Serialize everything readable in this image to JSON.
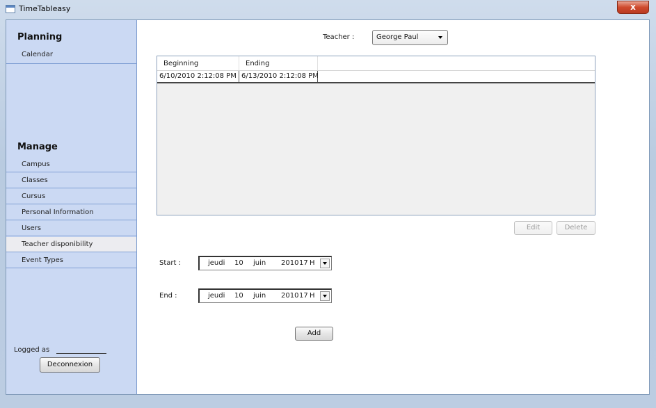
{
  "window": {
    "title": "TimeTableasy",
    "close_label": "x"
  },
  "sidebar": {
    "planning_title": "Planning",
    "planning_items": [
      {
        "label": "Calendar"
      }
    ],
    "manage_title": "Manage",
    "manage_items": [
      {
        "label": "Campus"
      },
      {
        "label": "Classes"
      },
      {
        "label": "Cursus"
      },
      {
        "label": "Personal Information"
      },
      {
        "label": "Users"
      },
      {
        "label": "Teacher disponibility"
      },
      {
        "label": "Event Types"
      }
    ],
    "selected_item": "Teacher disponibility",
    "logged_as_label": "Logged as",
    "logout_label": "Deconnexion"
  },
  "teacher": {
    "label": "Teacher :",
    "selected": "George Paul"
  },
  "grid": {
    "columns": [
      "Beginning",
      "Ending"
    ],
    "rows": [
      [
        "6/10/2010 2:12:08 PM",
        "6/13/2010 2:12:08 PM"
      ]
    ]
  },
  "actions": {
    "edit_label": "Edit",
    "delete_label": "Delete",
    "add_label": "Add"
  },
  "start": {
    "label": "Start :",
    "weekday": "jeudi",
    "day": "10",
    "month": "juin",
    "year": "2010",
    "hour": "17",
    "hour_suffix": "H"
  },
  "end": {
    "label": "End :",
    "weekday": "jeudi",
    "day": "10",
    "month": "juin",
    "year": "2010",
    "hour": "17",
    "hour_suffix": "H"
  }
}
